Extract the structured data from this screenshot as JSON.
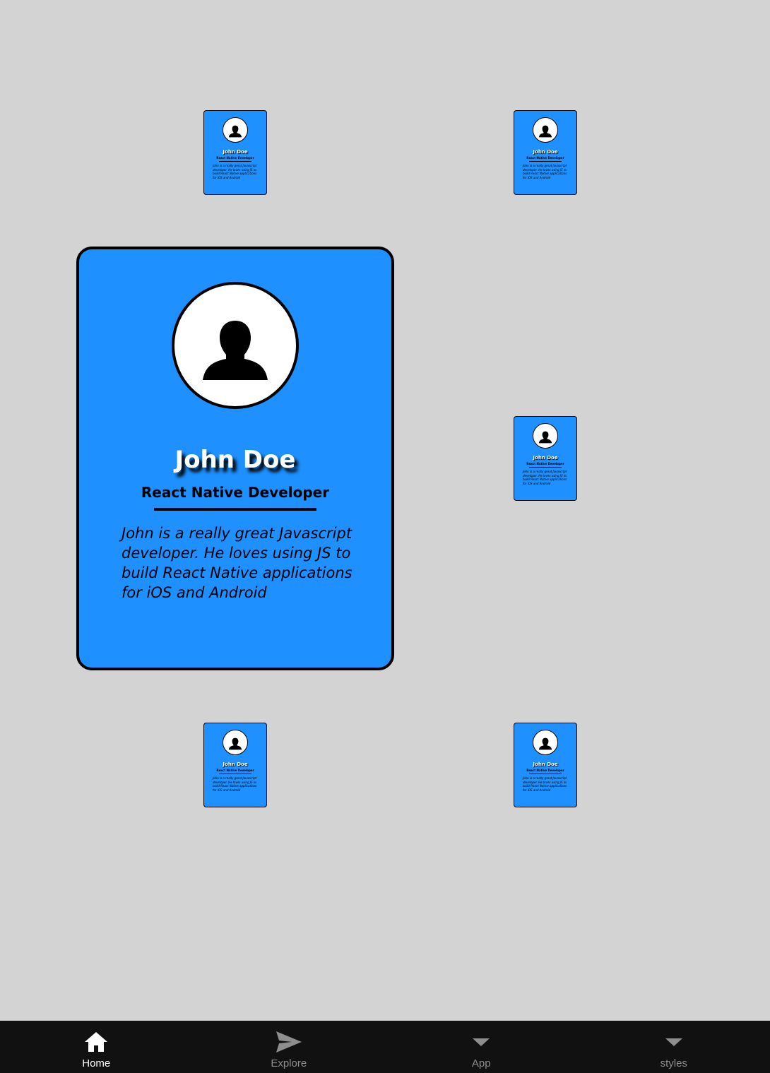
{
  "profile": {
    "name": "John Doe",
    "role": "React Native Developer",
    "bio": "John is a really great Javascript developer. He loves using JS to build React Native applications for iOS and Android"
  },
  "tabs": [
    {
      "label": "Home",
      "icon": "home-icon",
      "active": true
    },
    {
      "label": "Explore",
      "icon": "send-icon",
      "active": false
    },
    {
      "label": "App",
      "icon": "caret-down-icon",
      "active": false
    },
    {
      "label": "styles",
      "icon": "caret-down-icon",
      "active": false
    }
  ],
  "colors": {
    "background": "#d3d3d3",
    "card": "#1e90ff",
    "tabbar": "#111111",
    "tab_active": "#ffffff",
    "tab_inactive": "#8e8e8e"
  }
}
